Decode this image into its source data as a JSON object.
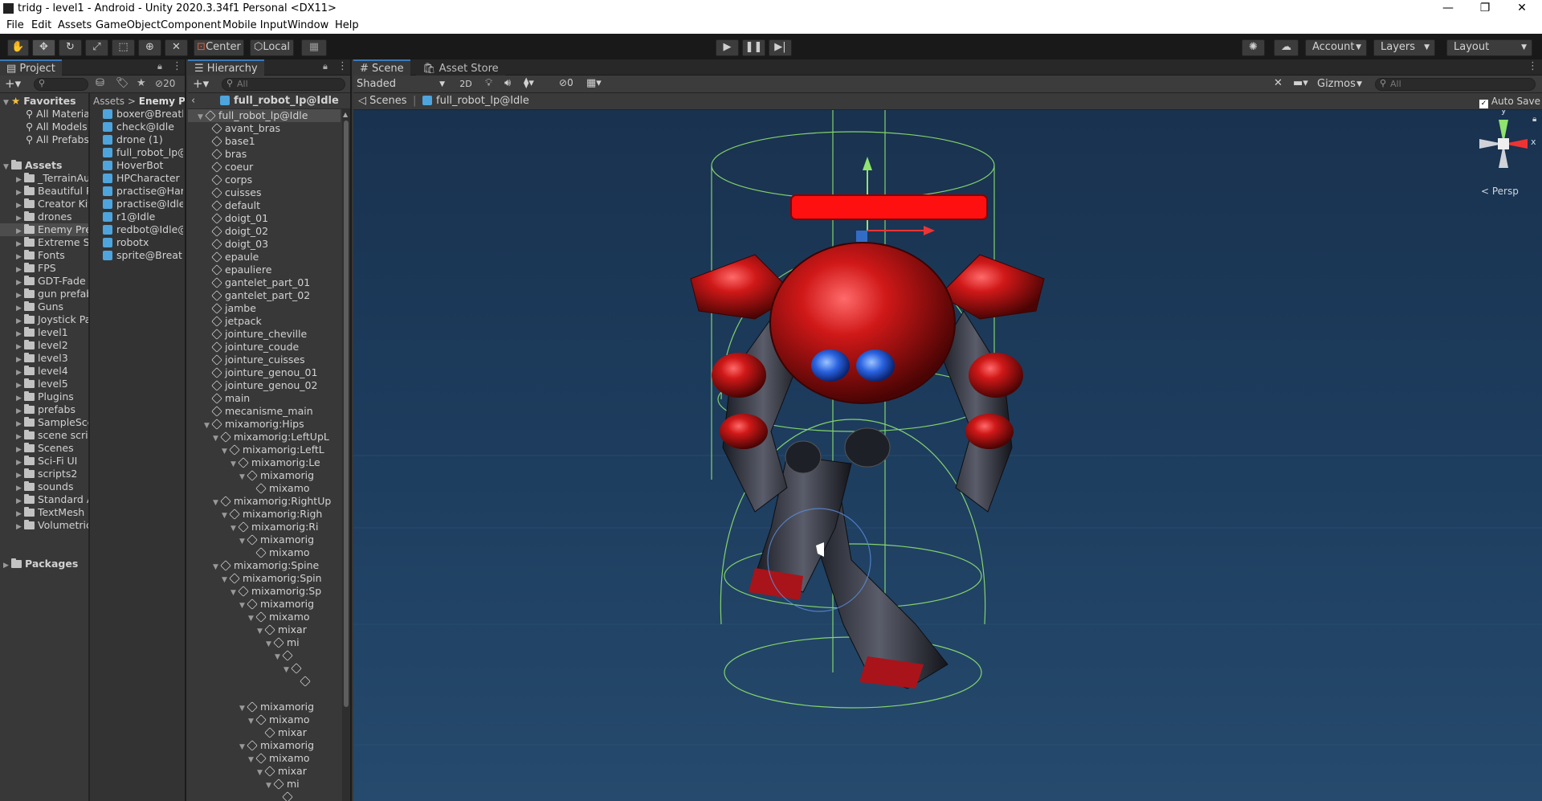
{
  "window": {
    "title": "tridg - level1 - Android - Unity 2020.3.34f1 Personal <DX11>",
    "minimize": "—",
    "maximize": "❐",
    "close": "✕"
  },
  "menu": [
    "File",
    "Edit",
    "Assets",
    "GameObject",
    "Component",
    "Mobile Input",
    "Window",
    "Help"
  ],
  "toolbar": {
    "center": "Center",
    "local": "Local",
    "account": "Account",
    "layers": "Layers",
    "layout": "Layout"
  },
  "project": {
    "tab": "Project",
    "hidden_count": "20",
    "favorites_label": "Favorites",
    "favorites": [
      "All Materia",
      "All Models",
      "All Prefabs"
    ],
    "assets_label": "Assets",
    "folders": [
      "_TerrainAu",
      "Beautiful P",
      "Creator Kit",
      "drones",
      "Enemy Pre",
      "Extreme Sc",
      "Fonts",
      "FPS",
      "GDT-Fade",
      "gun prefab",
      "Guns",
      "Joystick Pa",
      "level1",
      "level2",
      "level3",
      "level4",
      "level5",
      "Plugins",
      "prefabs",
      "SampleSce",
      "scene scrip",
      "Scenes",
      "Sci-Fi UI",
      "scripts2",
      "sounds",
      "Standard A",
      "TextMesh I",
      "Volumetric"
    ],
    "packages_label": "Packages",
    "breadcrumb_root": "Assets",
    "breadcrumb_sep": ">",
    "breadcrumb_current": "Enemy Pre",
    "files": [
      "boxer@Breathir",
      "check@Idle",
      "drone (1)",
      "full_robot_lp@Id",
      "HoverBot",
      "HPCharacter",
      "practise@Hard",
      "practise@Idle@",
      "r1@Idle",
      "redbot@Idle@Id",
      "robotx",
      "sprite@Breathir"
    ]
  },
  "hierarchy": {
    "tab": "Hierarchy",
    "search_placeholder": "All",
    "prefab_title": "full_robot_lp@Idle",
    "root": "full_robot_lp@Idle",
    "items": [
      {
        "label": "avant_bras",
        "depth": 0
      },
      {
        "label": "base1",
        "depth": 0
      },
      {
        "label": "bras",
        "depth": 0
      },
      {
        "label": "coeur",
        "depth": 0
      },
      {
        "label": "corps",
        "depth": 0
      },
      {
        "label": "cuisses",
        "depth": 0
      },
      {
        "label": "default",
        "depth": 0
      },
      {
        "label": "doigt_01",
        "depth": 0
      },
      {
        "label": "doigt_02",
        "depth": 0
      },
      {
        "label": "doigt_03",
        "depth": 0
      },
      {
        "label": "epaule",
        "depth": 0
      },
      {
        "label": "epauliere",
        "depth": 0
      },
      {
        "label": "gantelet_part_01",
        "depth": 0
      },
      {
        "label": "gantelet_part_02",
        "depth": 0
      },
      {
        "label": "jambe",
        "depth": 0
      },
      {
        "label": "jetpack",
        "depth": 0
      },
      {
        "label": "jointure_cheville",
        "depth": 0
      },
      {
        "label": "jointure_coude",
        "depth": 0
      },
      {
        "label": "jointure_cuisses",
        "depth": 0
      },
      {
        "label": "jointure_genou_01",
        "depth": 0
      },
      {
        "label": "jointure_genou_02",
        "depth": 0
      },
      {
        "label": "main",
        "depth": 0
      },
      {
        "label": "mecanisme_main",
        "depth": 0
      },
      {
        "label": "mixamorig:Hips",
        "depth": 0,
        "open": true
      },
      {
        "label": "mixamorig:LeftUpL",
        "depth": 1,
        "open": true
      },
      {
        "label": "mixamorig:LeftL",
        "depth": 2,
        "open": true
      },
      {
        "label": "mixamorig:Le",
        "depth": 3,
        "open": true
      },
      {
        "label": "mixamorig",
        "depth": 4,
        "open": true
      },
      {
        "label": "mixamo",
        "depth": 5
      },
      {
        "label": "mixamorig:RightUp",
        "depth": 1,
        "open": true
      },
      {
        "label": "mixamorig:Righ",
        "depth": 2,
        "open": true
      },
      {
        "label": "mixamorig:Ri",
        "depth": 3,
        "open": true
      },
      {
        "label": "mixamorig",
        "depth": 4,
        "open": true
      },
      {
        "label": "mixamo",
        "depth": 5
      },
      {
        "label": "mixamorig:Spine",
        "depth": 1,
        "open": true
      },
      {
        "label": "mixamorig:Spin",
        "depth": 2,
        "open": true
      },
      {
        "label": "mixamorig:Sp",
        "depth": 3,
        "open": true
      },
      {
        "label": "mixamorig",
        "depth": 4,
        "open": true
      },
      {
        "label": "mixamo",
        "depth": 5,
        "open": true
      },
      {
        "label": "mixar",
        "depth": 6,
        "open": true
      },
      {
        "label": "mi",
        "depth": 7,
        "open": true
      },
      {
        "label": "",
        "depth": 8,
        "open": true
      },
      {
        "label": "",
        "depth": 9,
        "open": true
      },
      {
        "label": "",
        "depth": 10
      },
      {
        "label": "",
        "depth": -1
      },
      {
        "label": "mixamorig",
        "depth": 4,
        "open": true
      },
      {
        "label": "mixamo",
        "depth": 5,
        "open": true
      },
      {
        "label": "mixar",
        "depth": 6
      },
      {
        "label": "mixamorig",
        "depth": 4,
        "open": true
      },
      {
        "label": "mixamo",
        "depth": 5,
        "open": true
      },
      {
        "label": "mixar",
        "depth": 6,
        "open": true
      },
      {
        "label": "mi",
        "depth": 7,
        "open": true
      },
      {
        "label": "",
        "depth": 8
      }
    ]
  },
  "scene": {
    "tab": "Scene",
    "asset_store_tab": "Asset Store",
    "shading": "Shaded",
    "mode2d": "2D",
    "hidden_count": "0",
    "gizmos": "Gizmos",
    "search_placeholder": "All",
    "breadcrumb_scenes": "Scenes",
    "breadcrumb_prefab": "full_robot_lp@Idle",
    "auto_save": "Auto Save",
    "auto_save_checked": true,
    "persp": "< Persp",
    "axis_y": "y",
    "axis_x": "x"
  }
}
